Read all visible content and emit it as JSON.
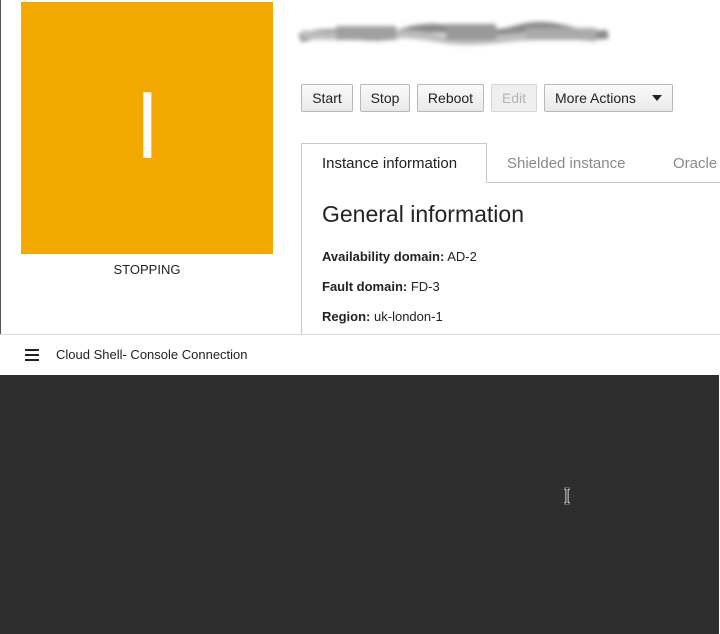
{
  "instance": {
    "icon_letter": "I",
    "icon_color": "#f3a800",
    "status": "STOPPING",
    "name_redacted": true
  },
  "actions": {
    "start": "Start",
    "stop": "Stop",
    "reboot": "Reboot",
    "edit": "Edit",
    "more": "More Actions"
  },
  "tabs": [
    {
      "label": "Instance information",
      "active": true
    },
    {
      "label": "Shielded instance",
      "active": false
    },
    {
      "label": "Oracle",
      "active": false
    }
  ],
  "general": {
    "title": "General information",
    "rows": [
      {
        "key": "Availability domain:",
        "value": "AD-2"
      },
      {
        "key": "Fault domain:",
        "value": "FD-3"
      },
      {
        "key": "Region:",
        "value": "uk-london-1"
      }
    ]
  },
  "cloud_shell": {
    "title": "Cloud Shell- Console Connection",
    "menu_icon": "hamburger-menu-icon",
    "background": "#2e2e2e"
  }
}
